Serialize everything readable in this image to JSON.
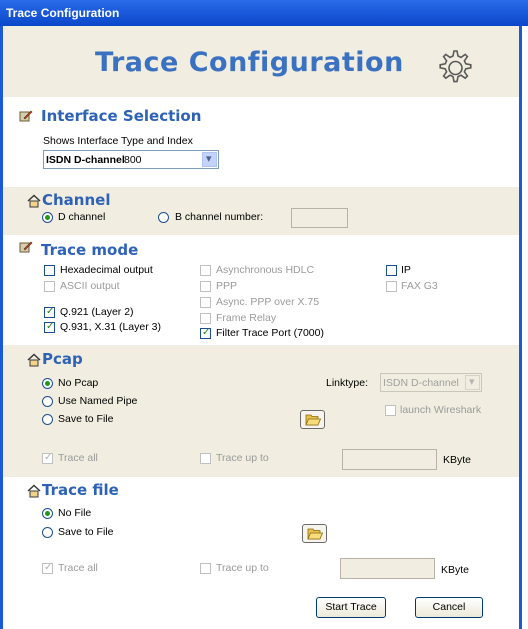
{
  "window": {
    "title": "Trace Configuration"
  },
  "header": {
    "title": "Trace Configuration",
    "icon": "gear-icon"
  },
  "interface": {
    "title": "Interface Selection",
    "description": "Shows Interface Type and Index",
    "selected_type": "ISDN D-channel",
    "selected_index": "800"
  },
  "channel": {
    "title": "Channel",
    "d_channel_label": "D channel",
    "b_channel_label": "B channel number:",
    "b_channel_value": "",
    "selected": "D channel"
  },
  "trace_mode": {
    "title": "Trace mode",
    "options": {
      "hex": {
        "label": "Hexadecimal output",
        "checked": false,
        "enabled": true
      },
      "ascii": {
        "label": "ASCII output",
        "checked": false,
        "enabled": false
      },
      "q921": {
        "label": "Q.921 (Layer 2)",
        "checked": true,
        "enabled": true
      },
      "q931": {
        "label": "Q.931, X.31 (Layer 3)",
        "checked": true,
        "enabled": true
      },
      "async_hdlc": {
        "label": "Asynchronous HDLC",
        "checked": false,
        "enabled": false
      },
      "ppp": {
        "label": "PPP",
        "checked": false,
        "enabled": false
      },
      "async_ppp": {
        "label": "Async. PPP over X.75",
        "checked": false,
        "enabled": false
      },
      "frame_relay": {
        "label": "Frame Relay",
        "checked": false,
        "enabled": false
      },
      "filter": {
        "label": "Filter Trace Port (7000)",
        "checked": true,
        "enabled": true
      },
      "ip": {
        "label": "IP",
        "checked": false,
        "enabled": true
      },
      "fax": {
        "label": "FAX G3",
        "checked": false,
        "enabled": false
      }
    }
  },
  "pcap": {
    "title": "Pcap",
    "no_pcap": "No Pcap",
    "named_pipe": "Use Named Pipe",
    "save_file": "Save to File",
    "selected": "No Pcap",
    "linktype_label": "Linktype:",
    "linktype_value": "ISDN D-channel",
    "launch_wireshark": "launch Wireshark",
    "trace_all": "Trace all",
    "trace_up_to": "Trace up to",
    "kbyte": "KByte"
  },
  "trace_file": {
    "title": "Trace file",
    "no_file": "No File",
    "save_file": "Save to File",
    "selected": "No File",
    "trace_all": "Trace all",
    "trace_up_to": "Trace up to",
    "kbyte": "KByte"
  },
  "buttons": {
    "start": "Start Trace",
    "cancel": "Cancel"
  },
  "colors": {
    "title_bar": "#0a46c9",
    "header_text": "#3a71c0",
    "section_bg": "#f1ede0",
    "section_title": "#2e62b6"
  }
}
